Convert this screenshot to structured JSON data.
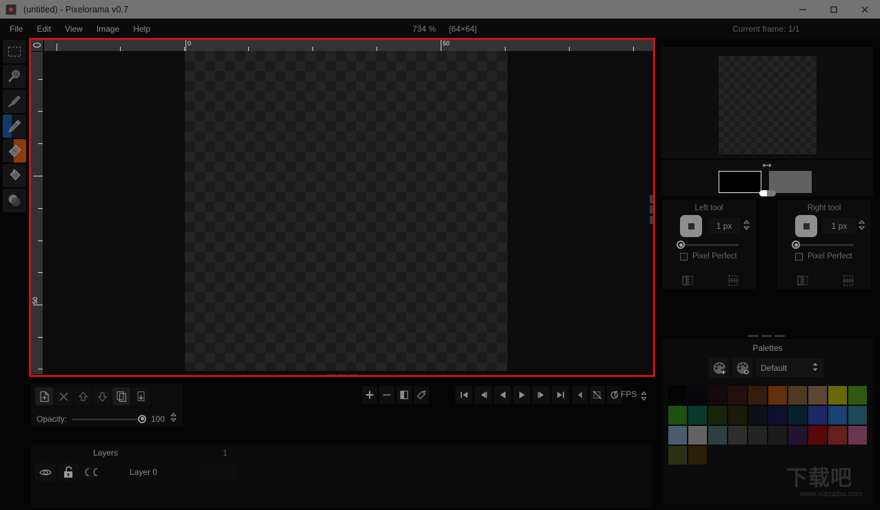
{
  "window": {
    "title": "(untitled) - Pixelorama v0.7",
    "app_icon": "pixelorama-icon",
    "minimize": "minimize-icon",
    "maximize": "maximize-icon",
    "close": "close-icon"
  },
  "menubar": {
    "items": [
      {
        "label": "File"
      },
      {
        "label": "Edit"
      },
      {
        "label": "View"
      },
      {
        "label": "Image"
      },
      {
        "label": "Help"
      }
    ]
  },
  "statusbar": {
    "zoom": "734 %",
    "canvas_size": "[64×64]",
    "current_frame": "Current frame: 1/1"
  },
  "toolbar": {
    "tools": [
      {
        "name": "rectangle-select-tool",
        "icon": "dashed-rectangle-icon",
        "active": false,
        "left_hint": false,
        "right_hint": false
      },
      {
        "name": "zoom-tool",
        "icon": "magnifier-icon",
        "active": false,
        "left_hint": false,
        "right_hint": false
      },
      {
        "name": "color-picker-tool",
        "icon": "eyedropper-icon",
        "active": false,
        "left_hint": false,
        "right_hint": false
      },
      {
        "name": "pencil-tool",
        "icon": "pencil-icon",
        "active": true,
        "left_hint": true,
        "right_hint": false
      },
      {
        "name": "eraser-tool",
        "icon": "eraser-icon",
        "active": true,
        "left_hint": false,
        "right_hint": true
      },
      {
        "name": "bucket-tool",
        "icon": "paint-bucket-icon",
        "active": false,
        "left_hint": false,
        "right_hint": false
      },
      {
        "name": "lighten-darken-tool",
        "icon": "circles-icon",
        "active": false,
        "left_hint": false,
        "right_hint": false
      }
    ]
  },
  "rulers": {
    "horizontal_labels": [
      "0",
      "50"
    ],
    "vertical_labels": [
      "0",
      "50"
    ]
  },
  "preview": {
    "label": "canvas-preview"
  },
  "colors": {
    "swap_icon": "swap-arrows-icon",
    "left_color": "#000000",
    "right_color": "#616161",
    "alpha_slider": "alpha-slider"
  },
  "tool_options": {
    "left": {
      "title": "Left tool",
      "brush_preview": "brush-preview",
      "size_value": "1 px",
      "size_slider_pct": 0,
      "pixel_perfect_label": "Pixel Perfect",
      "pixel_perfect_checked": false,
      "mirror_h": "mirror-horizontal-icon",
      "mirror_v": "mirror-vertical-icon"
    },
    "right": {
      "title": "Right tool",
      "brush_preview": "brush-preview",
      "size_value": "1 px",
      "size_slider_pct": 0,
      "pixel_perfect_label": "Pixel Perfect",
      "pixel_perfect_checked": false,
      "mirror_h": "mirror-horizontal-icon",
      "mirror_v": "mirror-vertical-icon"
    }
  },
  "palettes": {
    "title": "Palettes",
    "add_button": "add-palette-icon",
    "edit_button": "edit-palette-icon",
    "selected": "Default",
    "swatches": [
      "#040404",
      "#07070d",
      "#150a0b",
      "#23100c",
      "#341b0d",
      "#63300a",
      "#4e3a22",
      "#5b4534",
      "#6b6608",
      "#2e5a11",
      "#1c5210",
      "#083a2b",
      "#17260a",
      "#1a1a06",
      "#0d1016",
      "#0e1030",
      "#07202f",
      "#1b2767",
      "#1a4173",
      "#1c4a55",
      "#495b6e",
      "#636363",
      "#2e3f3f",
      "#2e2e2e",
      "#242424",
      "#1b1b1b",
      "#241330",
      "#590707",
      "#661e1e",
      "#6b3550",
      "#2c3015",
      "#2b1f06"
    ]
  },
  "layer_tools": {
    "buttons": [
      {
        "name": "add-layer-button",
        "icon": "page-plus-icon",
        "active": true
      },
      {
        "name": "delete-layer-button",
        "icon": "x-icon",
        "active": false
      },
      {
        "name": "move-layer-up-button",
        "icon": "arrow-up-icon",
        "active": false
      },
      {
        "name": "move-layer-down-button",
        "icon": "arrow-down-icon",
        "active": false
      },
      {
        "name": "duplicate-layer-button",
        "icon": "copy-pages-icon",
        "active": true
      },
      {
        "name": "merge-down-button",
        "icon": "merge-down-icon",
        "active": false
      }
    ],
    "opacity_label": "Opacity:",
    "opacity_value": "100"
  },
  "animation": {
    "frame_buttons": [
      {
        "name": "add-frame-button",
        "icon": "plus-icon"
      },
      {
        "name": "remove-frame-button",
        "icon": "minus-icon"
      },
      {
        "name": "duplicate-frame-button",
        "icon": "duplicate-frame-icon"
      },
      {
        "name": "tag-frame-button",
        "icon": "tag-icon"
      }
    ],
    "playback_buttons": [
      {
        "name": "first-frame-button",
        "icon": "skip-start-icon"
      },
      {
        "name": "previous-frame-button",
        "icon": "step-back-icon"
      },
      {
        "name": "play-backwards-button",
        "icon": "play-back-icon"
      },
      {
        "name": "play-forward-button",
        "icon": "play-icon"
      },
      {
        "name": "next-frame-button",
        "icon": "step-forward-icon"
      },
      {
        "name": "last-frame-button",
        "icon": "skip-end-icon"
      }
    ],
    "onion_buttons": [
      {
        "name": "onion-skin-past-button",
        "icon": "triangle-left-icon"
      },
      {
        "name": "onion-skin-toggle-button",
        "icon": "onion-skin-off-icon"
      },
      {
        "name": "loop-button",
        "icon": "loop-icon"
      }
    ],
    "fps_value": "6 FPS"
  },
  "layers_panel": {
    "header_title": "Layers",
    "header_count": "1",
    "rows": [
      {
        "visibility_icon": "eye-icon",
        "lock_icon": "unlocked-padlock-icon",
        "link_icon": "link-icon",
        "name": "Layer 0"
      }
    ]
  },
  "watermark": {
    "text": "下载吧",
    "url": "www.xiazaiba.com"
  },
  "theme": {
    "accent_red": "#cc1111",
    "titlebar_bg": "#737373",
    "panel_bg": "#0c0c0c",
    "text_dim": "#8a8a8a"
  }
}
